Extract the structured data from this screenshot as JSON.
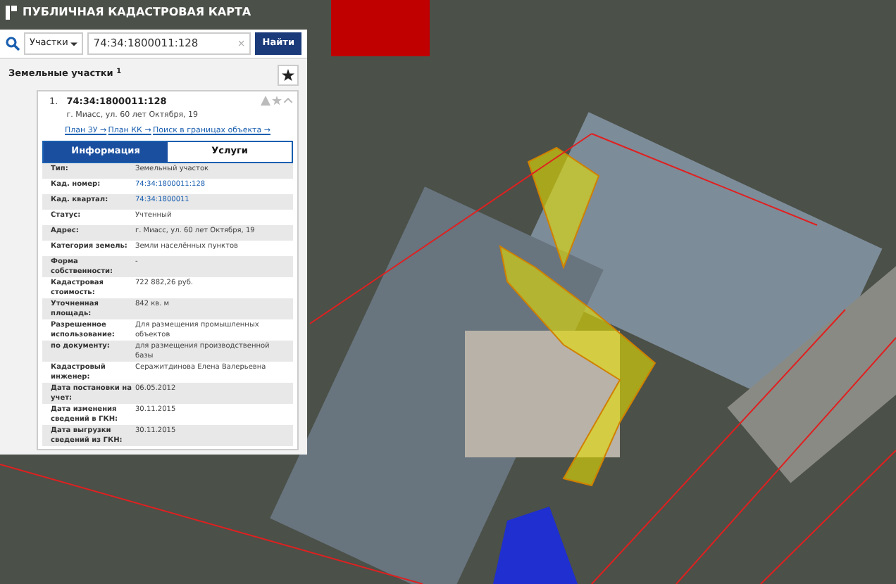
{
  "app_title": "ПУБЛИЧНАЯ КАДАСТРОВАЯ КАРТА",
  "search": {
    "category": "Участки",
    "value": "74:34:1800011:128",
    "clear": "×",
    "button": "Найти"
  },
  "results": {
    "title": "Земельные участки",
    "count": "1",
    "item": {
      "index": "1.",
      "number": "74:34:1800011:128",
      "address": "г. Миасс, ул. 60 лет Октября, 19",
      "links": [
        "План ЗУ →",
        "План КК →",
        "Поиск в границах объекта →"
      ],
      "tabs": [
        {
          "label": "Информация",
          "selected": true
        },
        {
          "label": "Услуги",
          "selected": false
        }
      ],
      "rows": [
        {
          "label": "Тип:",
          "value": "Земельный участок",
          "kind": "text"
        },
        {
          "label": "Кад. номер:",
          "value": "74:34:1800011:128",
          "kind": "link"
        },
        {
          "label": "Кад. квартал:",
          "value": "74:34:1800011",
          "kind": "link"
        },
        {
          "label": "Статус:",
          "value": "Учтенный",
          "kind": "text"
        },
        {
          "label": "Адрес:",
          "value": "г. Миасс, ул. 60 лет Октября, 19",
          "kind": "text"
        },
        {
          "label": "Категория земель:",
          "value": "Земли населённых пунктов",
          "kind": "text"
        },
        {
          "label": "Форма собственности:",
          "value": "-",
          "kind": "text"
        },
        {
          "label": "Кадастровая стоимость:",
          "value": "722 882,26 руб.",
          "kind": "text"
        },
        {
          "label": "Уточненная площадь:",
          "value": "842 кв. м",
          "kind": "text"
        },
        {
          "label": "Разрешенное использование:",
          "value": "Для размещения промышленных объектов",
          "kind": "text"
        },
        {
          "label": "по документу:",
          "value": "для размещения производственной базы",
          "kind": "text"
        },
        {
          "label": "Кадастровый инженер:",
          "value": "Серажитдинова Елена Валерьевна",
          "kind": "text"
        },
        {
          "label": "Дата постановки на учет:",
          "value": "06.05.2012",
          "kind": "text"
        },
        {
          "label": "Дата изменения сведений в ГКН:",
          "value": "30.11.2015",
          "kind": "text"
        },
        {
          "label": "Дата выгрузки сведений из ГКН:",
          "value": "30.11.2015",
          "kind": "text"
        }
      ]
    }
  }
}
